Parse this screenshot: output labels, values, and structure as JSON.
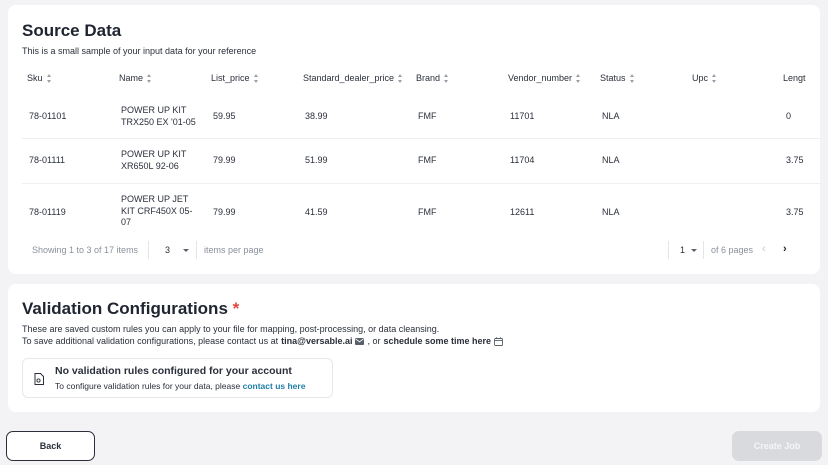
{
  "source": {
    "title": "Source Data",
    "subtitle": "This is a small sample of your input data for your reference",
    "columns": [
      "Sku",
      "Name",
      "List_price",
      "Standard_dealer_price",
      "Brand",
      "Vendor_number",
      "Status",
      "Upc",
      "Lengt"
    ],
    "rows": [
      {
        "sku": "78-01101",
        "name": "POWER UP KIT TRX250 EX '01-05",
        "list_price": "59.95",
        "dealer_price": "38.99",
        "brand": "FMF",
        "vendor_number": "11701",
        "status": "NLA",
        "upc": "",
        "length": "0"
      },
      {
        "sku": "78-01111",
        "name": "POWER UP KIT XR650L 92-06",
        "list_price": "79.99",
        "dealer_price": "51.99",
        "brand": "FMF",
        "vendor_number": "11704",
        "status": "NLA",
        "upc": "",
        "length": "3.75"
      },
      {
        "sku": "78-01119",
        "name": "POWER UP JET KIT CRF450X 05-07",
        "list_price": "79.99",
        "dealer_price": "41.59",
        "brand": "FMF",
        "vendor_number": "12611",
        "status": "NLA",
        "upc": "",
        "length": "3.75"
      }
    ],
    "pagination": {
      "showing": "Showing 1 to 3 of 17 items",
      "per_page_value": "3",
      "per_page_label": "items per page",
      "page_value": "1",
      "of_pages": "of 6 pages"
    }
  },
  "validation": {
    "title": "Validation Configurations",
    "required_mark": "*",
    "line1": "These are saved custom rules you can apply to your file for mapping, post-processing, or data cleansing.",
    "line2_prefix": "To save additional validation configurations, please contact us at",
    "email": "tina@versable.ai",
    "line2_mid": ", or",
    "schedule_link": "schedule some time here",
    "empty_title": "No validation rules configured for your account",
    "empty_text": "To configure validation rules for your data, please",
    "empty_link": "contact us here"
  },
  "footer": {
    "back_label": "Back",
    "create_label": "Create Job"
  },
  "icons": {
    "sort": "sort-icon",
    "mail": "mail-icon",
    "calendar": "calendar-icon",
    "file": "file-settings-icon",
    "dropdown": "chevron-down-icon",
    "prev": "chevron-left-icon",
    "next": "chevron-right-icon"
  },
  "colors": {
    "link": "#1f7ea8",
    "required": "#e0463f",
    "disabled_button": "#d9dadd"
  }
}
